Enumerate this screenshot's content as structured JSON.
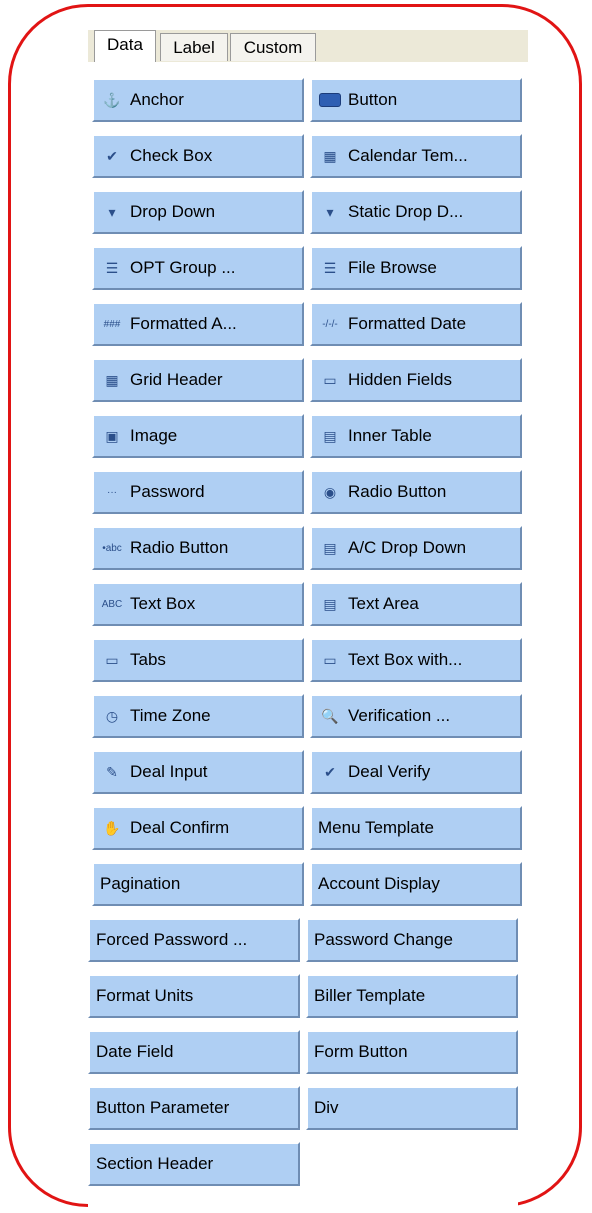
{
  "tabs": [
    "Data",
    "Label",
    "Custom"
  ],
  "left_items": [
    {
      "label": "Anchor",
      "icon": "anchor-icon",
      "glyph": "⚓"
    },
    {
      "label": "Check Box",
      "icon": "checkbox-icon",
      "glyph": "✔"
    },
    {
      "label": "Drop Down",
      "icon": "dropdown-icon",
      "glyph": "▾"
    },
    {
      "label": "OPT Group ...",
      "icon": "optgroup-icon",
      "glyph": "☰"
    },
    {
      "label": "Formatted A...",
      "icon": "formatted-amount-icon",
      "glyph": "###"
    },
    {
      "label": "Grid Header",
      "icon": "grid-header-icon",
      "glyph": "▦"
    },
    {
      "label": "Image",
      "icon": "image-icon",
      "glyph": "▣"
    },
    {
      "label": "Password",
      "icon": "password-icon",
      "glyph": "···"
    },
    {
      "label": "Radio Button",
      "icon": "radio-abc-icon",
      "glyph": "•abc"
    },
    {
      "label": "Text Box",
      "icon": "textbox-icon",
      "glyph": "ABC"
    },
    {
      "label": "Tabs",
      "icon": "tabs-icon",
      "glyph": "▭"
    },
    {
      "label": "Time Zone",
      "icon": "timezone-icon",
      "glyph": "◷"
    },
    {
      "label": "Deal Input",
      "icon": "deal-input-icon",
      "glyph": "✎"
    },
    {
      "label": "Deal Confirm",
      "icon": "deal-confirm-icon",
      "glyph": "✋"
    },
    {
      "label": "Pagination",
      "icon": "",
      "glyph": ""
    }
  ],
  "right_items": [
    {
      "label": "Button",
      "icon": "button-icon",
      "glyph": ""
    },
    {
      "label": "Calendar Tem...",
      "icon": "calendar-icon",
      "glyph": "▦"
    },
    {
      "label": "Static Drop D...",
      "icon": "static-dropdown-icon",
      "glyph": "▾"
    },
    {
      "label": "File Browse",
      "icon": "file-browse-icon",
      "glyph": "☰"
    },
    {
      "label": "Formatted Date",
      "icon": "formatted-date-icon",
      "glyph": "-/-/-"
    },
    {
      "label": "Hidden Fields",
      "icon": "hidden-fields-icon",
      "glyph": "▭"
    },
    {
      "label": "Inner Table",
      "icon": "inner-table-icon",
      "glyph": "▤"
    },
    {
      "label": "Radio Button",
      "icon": "radio-icon",
      "glyph": "◉"
    },
    {
      "label": "A/C Drop Down",
      "icon": "ac-dropdown-icon",
      "glyph": "▤"
    },
    {
      "label": "Text Area",
      "icon": "textarea-icon",
      "glyph": "▤"
    },
    {
      "label": "Text Box with...",
      "icon": "textbox-with-icon",
      "glyph": "▭"
    },
    {
      "label": "Verification ...",
      "icon": "verification-icon",
      "glyph": "🔍"
    },
    {
      "label": "Deal Verify",
      "icon": "deal-verify-icon",
      "glyph": "✔"
    },
    {
      "label": "Menu Template",
      "icon": "",
      "glyph": ""
    },
    {
      "label": "Account Display",
      "icon": "",
      "glyph": ""
    }
  ],
  "lower_left": [
    "Forced Password ...",
    "Format Units",
    "Date Field",
    "Button Parameter",
    "Section Header"
  ],
  "lower_right": [
    "Password Change",
    "Biller Template",
    "Form Button",
    "Div"
  ],
  "colors": {
    "button_bg": "#afcff3",
    "frame": "#e11414",
    "tabbar": "#ece9d8"
  }
}
